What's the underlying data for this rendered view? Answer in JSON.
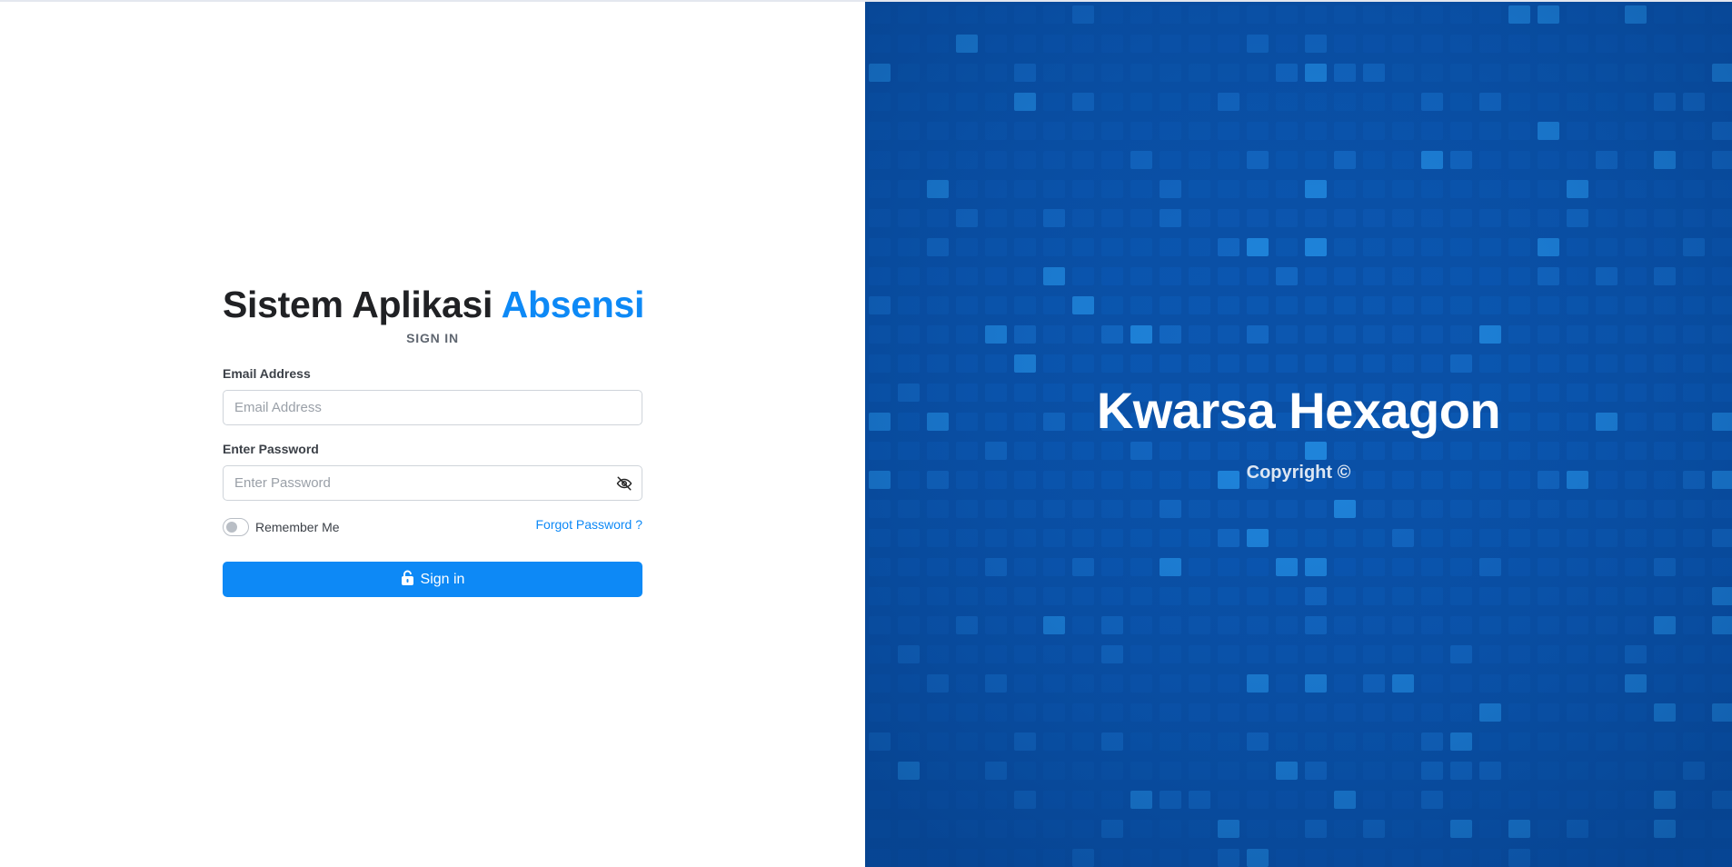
{
  "login": {
    "title_main": "Sistem Aplikasi",
    "title_accent": "Absensi",
    "subtitle": "SIGN IN",
    "email_label": "Email Address",
    "email_placeholder": "Email Address",
    "email_value": "",
    "password_label": "Enter Password",
    "password_placeholder": "Enter Password",
    "password_value": "",
    "password_toggle_icon": "eye-slash-icon",
    "remember_label": "Remember Me",
    "remember_checked": false,
    "forgot_link": "Forgot Password ?",
    "signin_icon": "unlock-icon",
    "signin_label": "Sign in"
  },
  "brand": {
    "title": "Kwarsa Hexagon",
    "copyright": "Copyright ©"
  },
  "colors": {
    "accent": "#0d89f6",
    "panel_blue": "#0a4fa3",
    "title_dark": "#202124"
  }
}
